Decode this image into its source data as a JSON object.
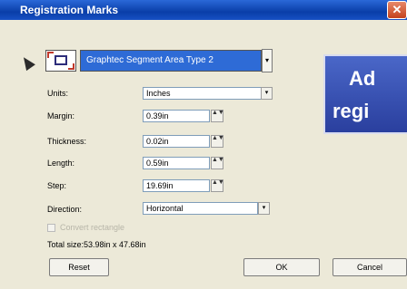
{
  "window": {
    "title": "Registration Marks",
    "close_glyph": "✕"
  },
  "mark_type": {
    "selected": "Graphtec Segment Area Type 2",
    "icon": "registration-mark-icon",
    "dropdown_glyph": "▾"
  },
  "fields": {
    "units": {
      "label": "Units:",
      "value": "Inches"
    },
    "margin": {
      "label": "Margin:",
      "value": "0.39in"
    },
    "thickness": {
      "label": "Thickness:",
      "value": "0.02in"
    },
    "length": {
      "label": "Length:",
      "value": "0.59in"
    },
    "step": {
      "label": "Step:",
      "value": "19.69in"
    },
    "direction": {
      "label": "Direction:",
      "value": "Horizontal"
    }
  },
  "spin_glyph": "▲▼",
  "checkbox": {
    "label": "Convert rectangle",
    "checked": false,
    "enabled": false
  },
  "total_size": "Total size:53.98in x 47.68in",
  "buttons": {
    "reset": "Reset",
    "ok": "OK",
    "cancel": "Cancel"
  },
  "overlay": {
    "line1": "Ad",
    "line2": "regi"
  }
}
